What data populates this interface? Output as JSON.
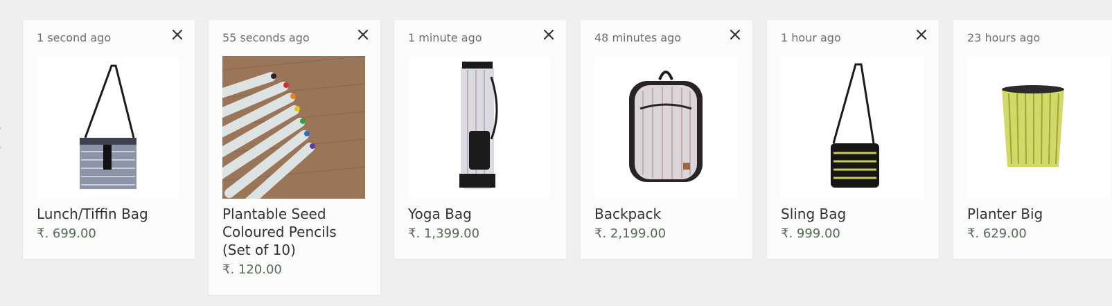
{
  "colors": {
    "background": "#efefef",
    "card": "#fbfbfb",
    "price": "#556b55",
    "time": "#6f6f6f"
  },
  "products": [
    {
      "time": "1 second ago",
      "name": "Lunch/Tiffin Bag",
      "price": "₹. 699.00",
      "image_icon": "lunch-bag-image"
    },
    {
      "time": "55 seconds ago",
      "name": "Plantable Seed Coloured Pencils (Set of 10)",
      "price": "₹. 120.00",
      "image_icon": "seed-pencils-image"
    },
    {
      "time": "1 minute ago",
      "name": "Yoga Bag",
      "price": "₹. 1,399.00",
      "image_icon": "yoga-bag-image"
    },
    {
      "time": "48 minutes ago",
      "name": "Backpack",
      "price": "₹. 2,199.00",
      "image_icon": "backpack-image"
    },
    {
      "time": "1 hour ago",
      "name": "Sling Bag",
      "price": "₹. 999.00",
      "image_icon": "sling-bag-image"
    },
    {
      "time": "23 hours ago",
      "name": "Planter Big",
      "price": "₹. 629.00",
      "image_icon": "planter-image"
    }
  ]
}
